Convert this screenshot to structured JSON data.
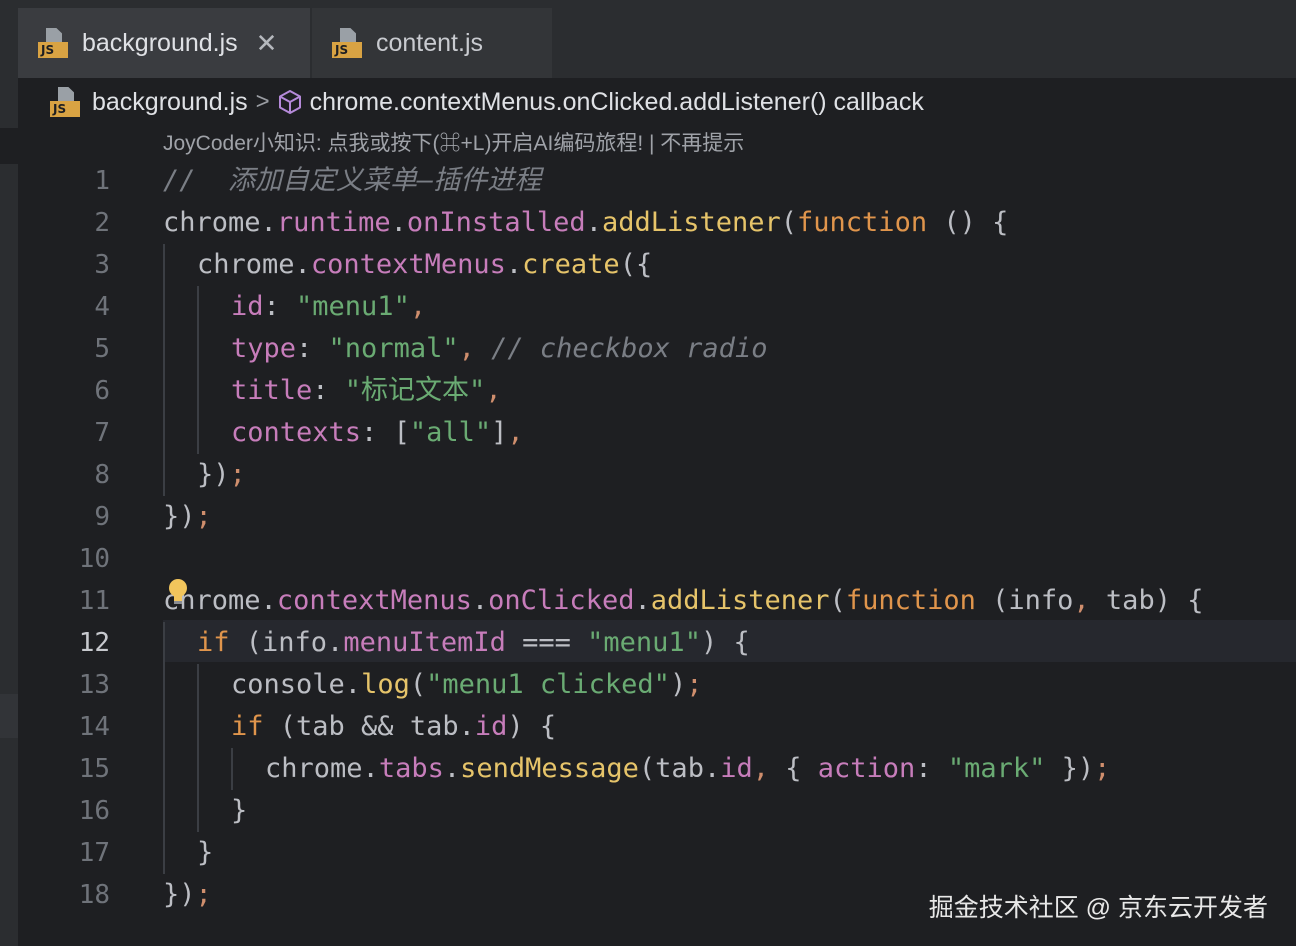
{
  "tabs": [
    {
      "label": "background.js",
      "active": true,
      "close_glyph": "✕"
    },
    {
      "label": "content.js",
      "active": false
    }
  ],
  "breadcrumb": {
    "file": "background.js",
    "separator": ">",
    "symbol": "chrome.contextMenus.onClicked.addListener() callback"
  },
  "hint": "JoyCoder小知识: 点我或按下(⌘+L)开启AI编码旅程! | 不再提示",
  "current_line": 12,
  "line_numbers": [
    "1",
    "2",
    "3",
    "4",
    "5",
    "6",
    "7",
    "8",
    "9",
    "10",
    "11",
    "12",
    "13",
    "14",
    "15",
    "16",
    "17",
    "18"
  ],
  "code": {
    "l1": {
      "comment": "//  添加自定义菜单—插件进程"
    },
    "l2": {
      "obj": "chrome",
      "d1": ".",
      "prop": "runtime",
      "d2": ".",
      "fn1": "onInstalled",
      "d3": ".",
      "fn2": "addListener",
      "p1": "(",
      "kw": "function",
      "rest": " () {"
    },
    "l3": {
      "obj": "chrome",
      "d1": ".",
      "prop": "contextMenus",
      "d2": ".",
      "fn": "create",
      "rest": "({"
    },
    "l4": {
      "key": "id",
      "colon": ": ",
      "str": "\"menu1\"",
      "comma": ","
    },
    "l5": {
      "key": "type",
      "colon": ": ",
      "str": "\"normal\"",
      "comma": ", ",
      "comment": "// checkbox radio"
    },
    "l6": {
      "key": "title",
      "colon": ": ",
      "str": "\"标记文本\"",
      "comma": ","
    },
    "l7": {
      "key": "contexts",
      "colon": ": ",
      "open": "[",
      "str": "\"all\"",
      "close": "]",
      "comma": ","
    },
    "l8": {
      "text": "})",
      "semi": ";"
    },
    "l9": {
      "text": "})",
      "semi": ";"
    },
    "l11": {
      "obj": "chrome",
      "d1": ".",
      "prop": "contextMenus",
      "d2": ".",
      "prop2": "onClicked",
      "d3": ".",
      "fn": "addListener",
      "p1": "(",
      "kw": "function",
      "rest1": " (info",
      "comma": ",",
      "rest2": " tab) {"
    },
    "l12": {
      "kw": "if",
      "p1": " (info.",
      "prop": "menuItemId",
      "op": " === ",
      "str": "\"menu1\"",
      "rest": ") {"
    },
    "l13": {
      "obj": "console",
      "d1": ".",
      "fn": "log",
      "p1": "(",
      "str": "\"menu1 clicked\"",
      "p2": ")",
      "semi": ";"
    },
    "l14": {
      "kw": "if",
      "p1": " (tab && tab.",
      "prop": "id",
      "rest": ") {"
    },
    "l15": {
      "obj": "chrome",
      "d1": ".",
      "prop": "tabs",
      "d2": ".",
      "fn": "sendMessage",
      "p1": "(tab.",
      "prop2": "id",
      "comma": ",",
      "p2": " { ",
      "key": "action",
      "colon": ": ",
      "str": "\"mark\"",
      "p3": " })",
      "semi": ";"
    },
    "l16": {
      "text": "}"
    },
    "l17": {
      "text": "}"
    },
    "l18": {
      "text": "})",
      "semi": ";"
    }
  },
  "watermark": "掘金技术社区 @ 京东云开发者",
  "colors": {
    "background": "#1e1f22",
    "keyword": "#e0954c",
    "string": "#6aab73",
    "property": "#c77dbb",
    "function": "#e6c46a",
    "comment": "#7a7e85"
  }
}
